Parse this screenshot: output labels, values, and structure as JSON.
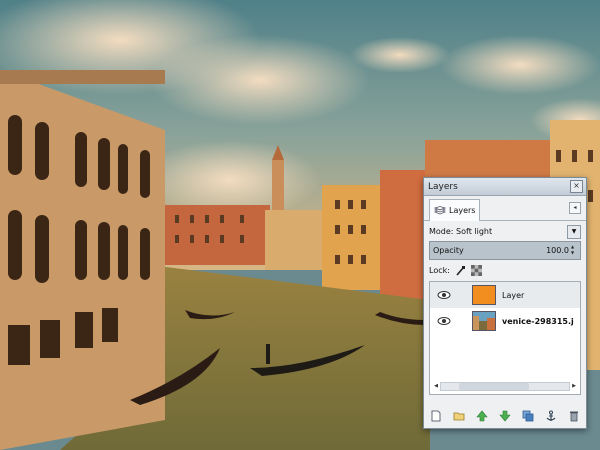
{
  "window": {
    "title": "Layers",
    "close_label": "×"
  },
  "tab": {
    "label": "Layers",
    "menu_label": "◂"
  },
  "mode": {
    "label": "Mode:",
    "value": "Soft light"
  },
  "opacity": {
    "label": "Opacity",
    "value": "100.0"
  },
  "lock": {
    "label": "Lock:"
  },
  "layers": [
    {
      "name": "Layer",
      "selected": true,
      "thumb": "orange"
    },
    {
      "name": "venice-298315.j",
      "selected": false,
      "thumb": "photo"
    }
  ],
  "toolbar": {
    "icons": [
      "new-layer-icon",
      "new-layer-group-icon",
      "raise-layer-icon",
      "lower-layer-icon",
      "duplicate-layer-icon",
      "anchor-layer-icon",
      "delete-layer-icon"
    ]
  },
  "colors": {
    "thumb_orange": "#f28e20",
    "accent": "#b8c3cc"
  }
}
